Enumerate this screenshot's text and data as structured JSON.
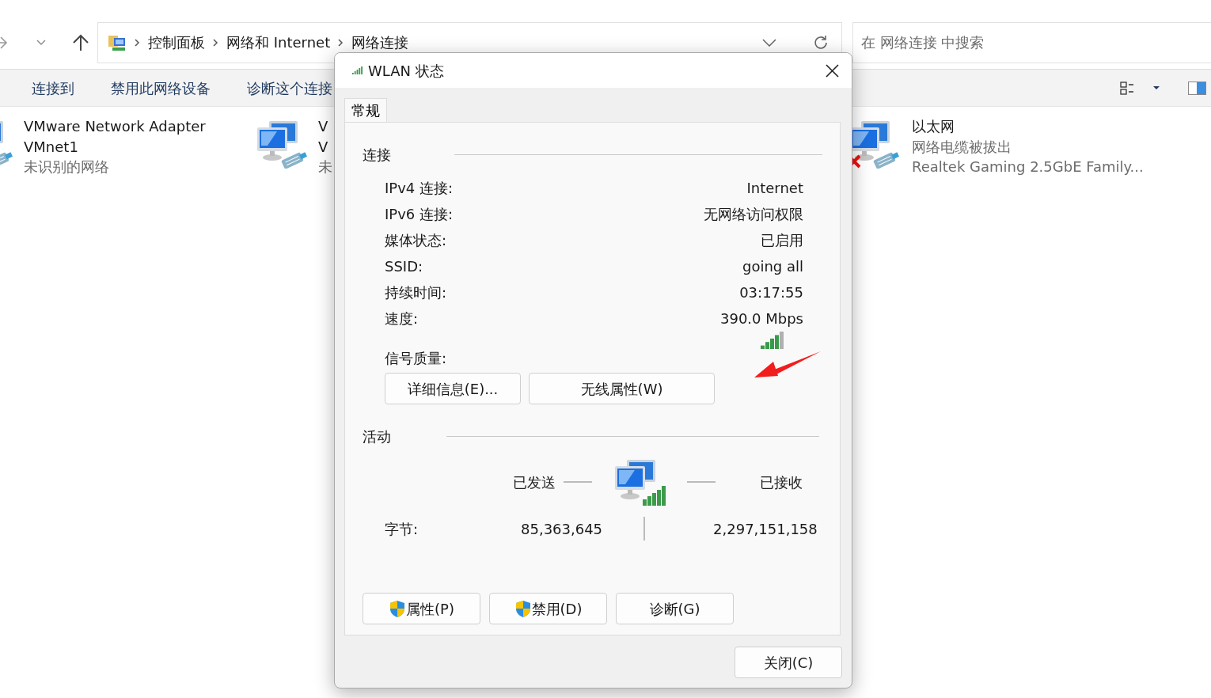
{
  "address_bar": {
    "crumbs": [
      "控制面板",
      "网络和 Internet",
      "网络连接"
    ]
  },
  "search": {
    "placeholder": "在 网络连接 中搜索"
  },
  "toolbar": {
    "items": [
      "连接到",
      "禁用此网络设备",
      "诊断这个连接"
    ]
  },
  "adapters": [
    {
      "lines": [
        "VMware Network Adapter",
        "VMnet1"
      ],
      "status": "未识别的网络"
    },
    {
      "lines": [
        "V",
        "V"
      ],
      "status": "未",
      "disconnected": false
    },
    {
      "lines": [
        "以太网"
      ],
      "status": "网络电缆被拔出",
      "device": "Realtek Gaming 2.5GbE Family...",
      "disconnected": true
    }
  ],
  "dialog": {
    "title": "WLAN 状态",
    "tabs": [
      {
        "label": "常规",
        "selected": true
      }
    ],
    "connection": {
      "heading": "连接",
      "rows": [
        {
          "label": "IPv4 连接:",
          "value": "Internet"
        },
        {
          "label": "IPv6 连接:",
          "value": "无网络访问权限"
        },
        {
          "label": "媒体状态:",
          "value": "已启用"
        },
        {
          "label": "SSID:",
          "value": "going all"
        },
        {
          "label": "持续时间:",
          "value": "03:17:55"
        },
        {
          "label": "速度:",
          "value": "390.0 Mbps"
        }
      ],
      "signal_label": "信号质量:",
      "buttons": [
        "详细信息(E)...",
        "无线属性(W)"
      ]
    },
    "activity": {
      "heading": "活动",
      "sent_label": "已发送",
      "received_label": "已接收",
      "bytes_label": "字节:",
      "sent": "85,363,645",
      "received": "2,297,151,158"
    },
    "buttons": [
      {
        "label": "属性(P)",
        "shield": true
      },
      {
        "label": "禁用(D)",
        "shield": true
      },
      {
        "label": "诊断(G)",
        "shield": false
      }
    ],
    "close_button": "关闭(C)"
  }
}
